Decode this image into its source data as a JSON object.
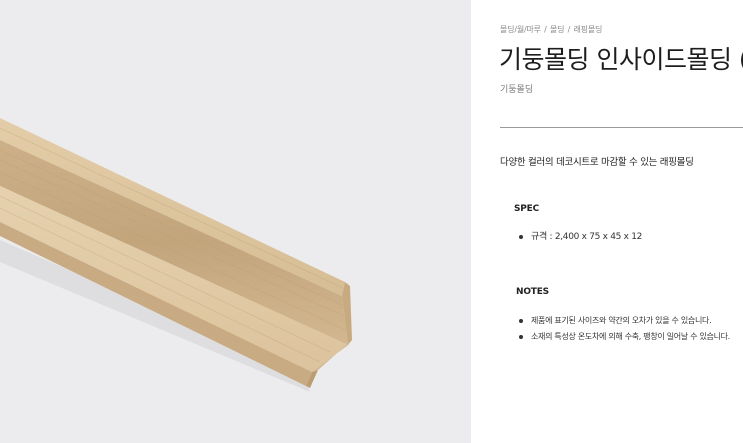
{
  "product": {
    "breadcrumb": [
      "몰딩/월/마루",
      "몰딩",
      "래핑몰딩"
    ],
    "title": "기둥몰딩 인사이드몰딩 (",
    "subtitle": "기둥몰딩",
    "description": "다양한 컬러의 데코시트로 마감할 수 있는 래핑몰딩"
  },
  "spec": {
    "heading": "SPEC",
    "items": [
      "규격 : 2,400 x 75 x 45 x 12"
    ]
  },
  "notes": {
    "heading": "NOTES",
    "items": [
      "제품에 표기된 사이즈와 약간의 오차가 있을 수 있습니다.",
      "소재의 특성상 온도차에 의해 수축, 팽창이 일어날 수 있습니다."
    ]
  },
  "colors": {
    "image_background": "#ececee",
    "wood_light": "#dcc39c",
    "wood_mid": "#c9ad84",
    "wood_dark": "#b89a70",
    "divider": "#9a9a9a"
  }
}
